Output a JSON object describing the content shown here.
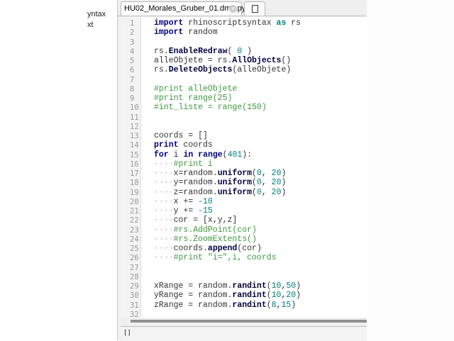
{
  "left_panel": {
    "fragments": [
      "yntax",
      "xt"
    ]
  },
  "tabs": [
    {
      "label": "HU02_Morales_Gruber_01.dm2.py*",
      "close_icon": "close-icon"
    },
    {
      "icon": "new-document-icon"
    }
  ],
  "code_lines": [
    [
      [
        "kw",
        "import"
      ],
      [
        "t",
        " rhinoscriptsyntax "
      ],
      [
        "as",
        "as"
      ],
      [
        "t",
        " rs"
      ]
    ],
    [
      [
        "kw",
        "import"
      ],
      [
        "t",
        " random"
      ]
    ],
    [],
    [
      [
        "t",
        "rs."
      ],
      [
        "fn",
        "EnableRedraw"
      ],
      [
        "t",
        "( "
      ],
      [
        "num",
        "0"
      ],
      [
        "t",
        " )"
      ]
    ],
    [
      [
        "t",
        "alleObjete = rs."
      ],
      [
        "fn",
        "AllObjects"
      ],
      [
        "t",
        "()"
      ]
    ],
    [
      [
        "t",
        "rs."
      ],
      [
        "fn",
        "DeleteObjects"
      ],
      [
        "t",
        "(alleObjete)"
      ]
    ],
    [],
    [
      [
        "cm",
        "#print alleObjete"
      ]
    ],
    [
      [
        "cm",
        "#print range(25)"
      ]
    ],
    [
      [
        "cm",
        "#int_liste = range(150)"
      ]
    ],
    [],
    [],
    [
      [
        "t",
        "coords = []"
      ]
    ],
    [
      [
        "kw",
        "print"
      ],
      [
        "t",
        " coords"
      ]
    ],
    [
      [
        "kw",
        "for"
      ],
      [
        "t",
        " i "
      ],
      [
        "kw",
        "in"
      ],
      [
        "t",
        " "
      ],
      [
        "kw",
        "range"
      ],
      [
        "t",
        "("
      ],
      [
        "num",
        "401"
      ],
      [
        "t",
        "):"
      ]
    ],
    [
      [
        "ws",
        "····"
      ],
      [
        "cm",
        "#print i"
      ]
    ],
    [
      [
        "ws",
        "····"
      ],
      [
        "t",
        "x=random."
      ],
      [
        "fn",
        "uniform"
      ],
      [
        "t",
        "("
      ],
      [
        "num",
        "0"
      ],
      [
        "t",
        ", "
      ],
      [
        "num",
        "20"
      ],
      [
        "t",
        ")"
      ]
    ],
    [
      [
        "ws",
        "····"
      ],
      [
        "t",
        "y=random."
      ],
      [
        "fn",
        "uniform"
      ],
      [
        "t",
        "("
      ],
      [
        "num",
        "0"
      ],
      [
        "t",
        ", "
      ],
      [
        "num",
        "20"
      ],
      [
        "t",
        ")"
      ]
    ],
    [
      [
        "ws",
        "····"
      ],
      [
        "t",
        "z=random."
      ],
      [
        "fn",
        "uniform"
      ],
      [
        "t",
        "("
      ],
      [
        "num",
        "0"
      ],
      [
        "t",
        ", "
      ],
      [
        "num",
        "20"
      ],
      [
        "t",
        ")"
      ]
    ],
    [
      [
        "ws",
        "····"
      ],
      [
        "t",
        "x += "
      ],
      [
        "num",
        "-10"
      ]
    ],
    [
      [
        "ws",
        "····"
      ],
      [
        "t",
        "y += "
      ],
      [
        "num",
        "-15"
      ]
    ],
    [
      [
        "ws",
        "····"
      ],
      [
        "t",
        "cor = [x,y,z]"
      ]
    ],
    [
      [
        "ws",
        "····"
      ],
      [
        "cm",
        "#rs.AddPoint(cor)"
      ]
    ],
    [
      [
        "ws",
        "····"
      ],
      [
        "cm",
        "#rs.ZoomExtents()"
      ]
    ],
    [
      [
        "ws",
        "····"
      ],
      [
        "t",
        "coords."
      ],
      [
        "fn",
        "append"
      ],
      [
        "t",
        "(cor)"
      ]
    ],
    [
      [
        "ws",
        "····"
      ],
      [
        "cm",
        "#print \"i=\",i, coords"
      ]
    ],
    [],
    [],
    [
      [
        "t",
        "xRange = random."
      ],
      [
        "fn",
        "randint"
      ],
      [
        "t",
        "("
      ],
      [
        "num",
        "10"
      ],
      [
        "t",
        ","
      ],
      [
        "num",
        "50"
      ],
      [
        "t",
        ")"
      ]
    ],
    [
      [
        "t",
        "yRange = random."
      ],
      [
        "fn",
        "randint"
      ],
      [
        "t",
        "("
      ],
      [
        "num",
        "10"
      ],
      [
        "t",
        ","
      ],
      [
        "num",
        "20"
      ],
      [
        "t",
        ")"
      ]
    ],
    [
      [
        "t",
        "zRange = random."
      ],
      [
        "fn",
        "randint"
      ],
      [
        "t",
        "("
      ],
      [
        "num",
        "8"
      ],
      [
        "t",
        ","
      ],
      [
        "num",
        "15"
      ],
      [
        "t",
        ")"
      ]
    ],
    []
  ],
  "output": {
    "text": "[]"
  }
}
